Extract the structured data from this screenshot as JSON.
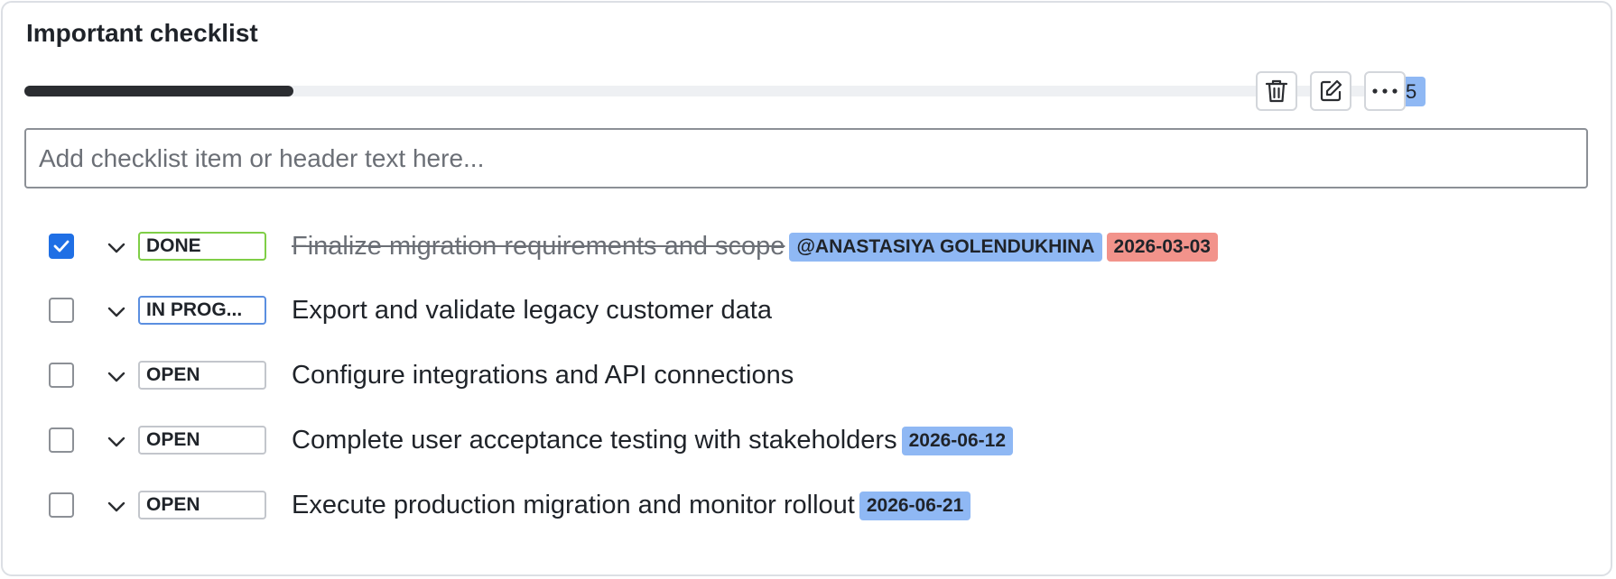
{
  "checklist": {
    "title": "Important checklist",
    "progress": {
      "done": 1,
      "total": 5,
      "label": "1/5"
    },
    "input_placeholder": "Add checklist item or header text here...",
    "actions": {
      "delete_icon": "trash-icon",
      "edit_icon": "edit-icon",
      "more_icon": "more-icon"
    },
    "items": [
      {
        "checked": true,
        "status": "DONE",
        "text": "Finalize migration requirements and scope",
        "mention": "@ANASTASIYA GOLENDUKHINA",
        "date": "2026-03-03",
        "date_color": "#f2938b"
      },
      {
        "checked": false,
        "status": "IN PROG...",
        "text": "Export and validate legacy customer data"
      },
      {
        "checked": false,
        "status": "OPEN",
        "text": "Configure integrations and API connections"
      },
      {
        "checked": false,
        "status": "OPEN",
        "text": "Complete user acceptance testing with stakeholders",
        "date": "2026-06-12",
        "date_color": "#8fb8f4"
      },
      {
        "checked": false,
        "status": "OPEN",
        "text": "Execute production migration and monitor rollout",
        "date": "2026-06-21",
        "date_color": "#8fb8f4"
      }
    ]
  },
  "colors": {
    "accent": "#1f6fe5",
    "progress_fill": "#2b2d31",
    "tag_blue": "#8fb8f4",
    "tag_red": "#f2938b",
    "status_done_border": "#7fce47",
    "status_inprogress_border": "#5b8fe0"
  }
}
